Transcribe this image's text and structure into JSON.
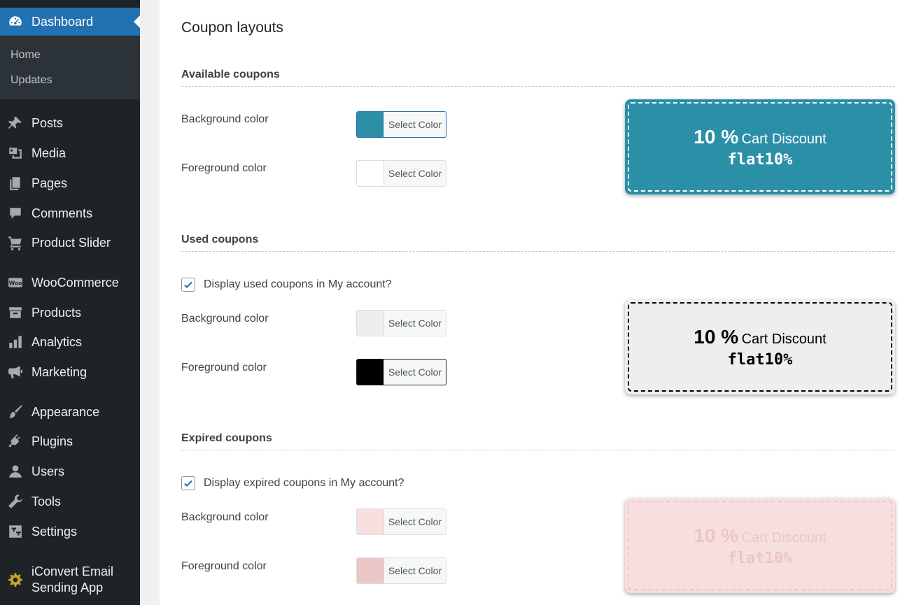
{
  "sidebar": {
    "dashboard": "Dashboard",
    "submenu": {
      "home": "Home",
      "updates": "Updates"
    },
    "items": [
      {
        "label": "Posts",
        "icon": "pin-icon"
      },
      {
        "label": "Media",
        "icon": "media-icon"
      },
      {
        "label": "Pages",
        "icon": "pages-icon"
      },
      {
        "label": "Comments",
        "icon": "comment-icon"
      },
      {
        "label": "Product Slider",
        "icon": "cart-icon"
      },
      {
        "label": "WooCommerce",
        "icon": "woo-icon"
      },
      {
        "label": "Products",
        "icon": "archive-icon"
      },
      {
        "label": "Analytics",
        "icon": "chart-bar-icon"
      },
      {
        "label": "Marketing",
        "icon": "megaphone-icon"
      },
      {
        "label": "Appearance",
        "icon": "brush-icon"
      },
      {
        "label": "Plugins",
        "icon": "plugin-icon"
      },
      {
        "label": "Users",
        "icon": "user-icon"
      },
      {
        "label": "Tools",
        "icon": "wrench-icon"
      },
      {
        "label": "Settings",
        "icon": "settings-icon"
      }
    ],
    "iconvert": {
      "line1": "iConvert Email",
      "line2": "Sending App"
    }
  },
  "content": {
    "page_title": "Coupon layouts",
    "select_color": "Select Color",
    "background_color_label": "Background color",
    "foreground_color_label": "Foreground color",
    "available": {
      "title": "Available coupons",
      "bg": "#2b8fa8",
      "fg": "#ffffff"
    },
    "used": {
      "title": "Used coupons",
      "checkbox_label": "Display used coupons in My account?",
      "checked": true,
      "bg": "#eeeeee",
      "fg": "#000000"
    },
    "expired": {
      "title": "Expired coupons",
      "checkbox_label": "Display expired coupons in My account?",
      "checked": true,
      "bg": "#f7dfdf",
      "fg": "#ecc6c6"
    },
    "coupon_preview": {
      "amount": "10 %",
      "type": "Cart Discount",
      "code": "flat10%"
    }
  }
}
